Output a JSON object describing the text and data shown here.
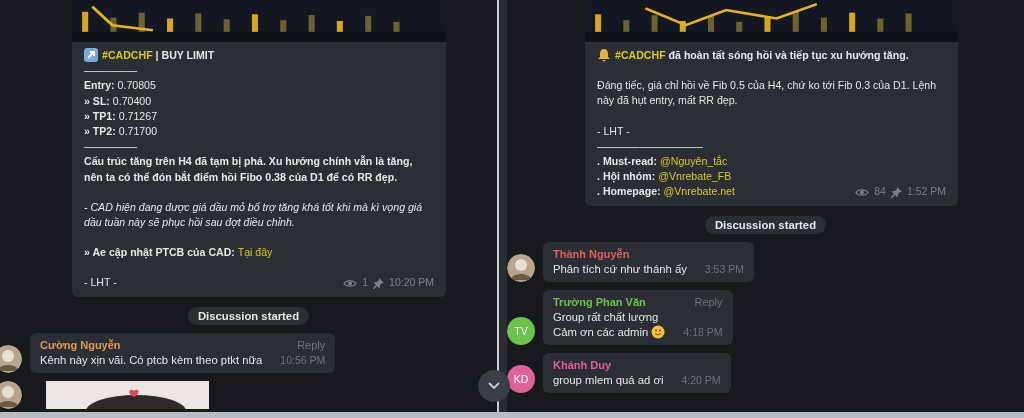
{
  "panels": [
    {
      "post": {
        "paragraphs": [
          [
            [
              {
                "kind": "hashtag",
                "text": "#CADCHF"
              },
              {
                "kind": "bold",
                "text": "| BUY LIMIT"
              }
            ],
            [
              {
                "kind": "plain",
                "text": "—————"
              }
            ],
            [
              {
                "kind": "bold",
                "text": "Entry:"
              },
              {
                "kind": "plain",
                "text": "0.70805"
              }
            ],
            [
              {
                "kind": "bold",
                "text": "» SL:"
              },
              {
                "kind": "plain",
                "text": "0.70400"
              }
            ],
            [
              {
                "kind": "bold",
                "text": "» TP1:"
              },
              {
                "kind": "plain",
                "text": "0.71267"
              }
            ],
            [
              {
                "kind": "bold",
                "text": "» TP2:"
              },
              {
                "kind": "plain",
                "text": "0.71700"
              }
            ],
            [
              {
                "kind": "plain",
                "text": "—————"
              }
            ],
            [
              {
                "kind": "bold",
                "text": "Cấu trúc tăng trên H4 đã tạm bị phá. Xu hướng chính vẫn là tăng, nên ta có thể đón bắt điểm hồi Fibo 0.38 của D1 để có RR đẹp."
              }
            ]
          ],
          [
            [
              {
                "kind": "italic",
                "text": "- CAD hiện đang được giá dầu mỏ bổ trợ tăng khá tốt khi mà kì vọng giá dầu tuần này sẽ phục hồi sau đợt điều chỉnh."
              }
            ]
          ],
          [
            [
              {
                "kind": "bold",
                "text": "» Ae cập nhật PTCB của CAD:"
              },
              {
                "kind": "link",
                "text": "Tại đây"
              }
            ]
          ],
          [
            [
              {
                "kind": "plain",
                "text": "- LHT -"
              }
            ]
          ]
        ],
        "views": "1",
        "time": "10:20 PM"
      },
      "service": "Discussion started",
      "comments": [
        {
          "avatar": {
            "kind": "picture"
          },
          "name": "Cường Nguyễn",
          "color": "#e39a4a",
          "reply": "Reply",
          "lines": [
            "Kênh này xịn vãi. Có ptcb kèm theo ptkt nữa"
          ],
          "time": "10:56 PM"
        },
        {
          "avatar": {
            "kind": "picture"
          }
        }
      ]
    },
    {
      "post": {
        "paragraphs": [
          [
            [
              {
                "kind": "hashtag",
                "text": "#CADCHF"
              },
              {
                "kind": "bold",
                "text": "đã hoàn tất sóng hồi và tiếp tục xu hướng tăng."
              }
            ]
          ],
          [
            [
              {
                "kind": "plain",
                "text": "Đáng tiếc, giá chỉ hồi về Fib 0.5 của H4, chứ ko tới Fib 0.3 của D1. Lệnh này đã hụt entry, mất RR đẹp."
              }
            ]
          ],
          [
            [
              {
                "kind": "plain",
                "text": "- LHT -"
              }
            ],
            [
              {
                "kind": "plain",
                "text": "——————————"
              }
            ],
            [
              {
                "kind": "bold",
                "text": ". Must-read:"
              },
              {
                "kind": "link",
                "text": "@Nguyên_tắc"
              }
            ],
            [
              {
                "kind": "bold",
                "text": ". Hội nhóm:"
              },
              {
                "kind": "link",
                "text": "@Vnrebate_FB"
              }
            ],
            [
              {
                "kind": "bold",
                "text": ". Homepage:"
              },
              {
                "kind": "link",
                "text": "@Vnrebate.net"
              }
            ]
          ]
        ],
        "views": "84",
        "time": "1:52 PM"
      },
      "service": "Discussion started",
      "comments": [
        {
          "avatar": {
            "kind": "picture"
          },
          "name": "Thành Nguyễn",
          "color": "#e0605e",
          "lines": [
            "Phân tích cứ như thánh ấy"
          ],
          "time": "3:53 PM"
        },
        {
          "avatar": {
            "kind": "initials",
            "text": "TV",
            "color": "#6cc24a"
          },
          "name": "Trường Phan Văn",
          "color": "#6cc24a",
          "reply": "Reply",
          "lines": [
            "Group rất chất lượng",
            "Cảm ơn các admin"
          ],
          "emoji": true,
          "time": "4:18 PM"
        },
        {
          "avatar": {
            "kind": "initials",
            "text": "KD",
            "color": "#e0609a"
          },
          "name": "Khánh Duy",
          "color": "#e0609a",
          "lines": [
            "group mlem quá ad ơi"
          ],
          "time": "4:20 PM"
        }
      ]
    }
  ]
}
